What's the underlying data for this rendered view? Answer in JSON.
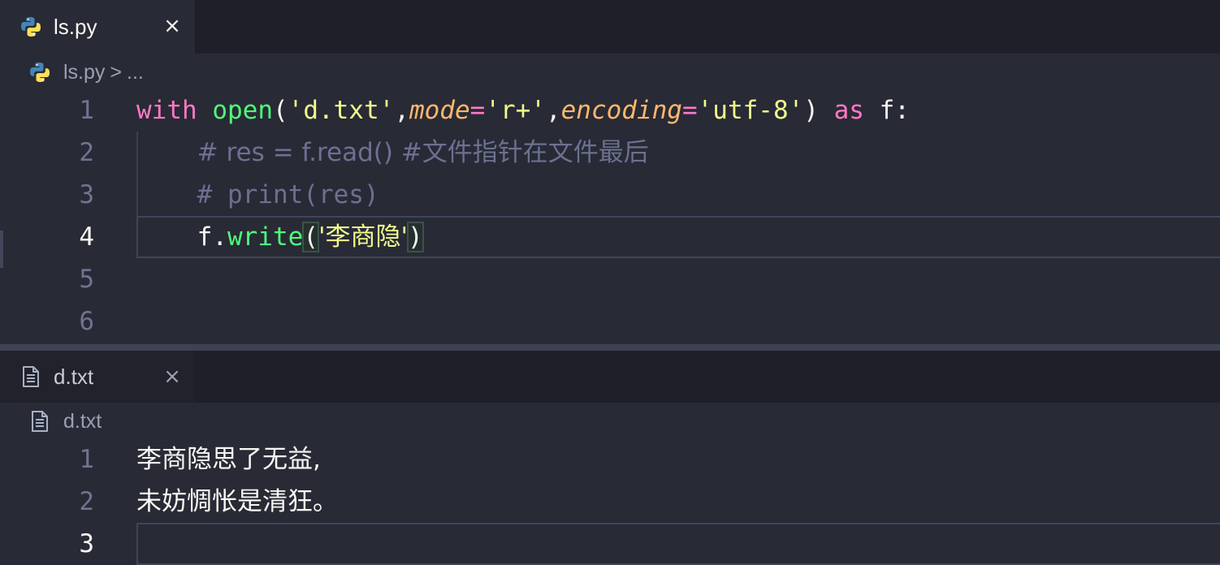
{
  "top_editor": {
    "tab": {
      "label": "ls.py",
      "close": "×",
      "icon": "python-icon"
    },
    "breadcrumb": {
      "file": "ls.py",
      "separator": ">",
      "rest": "..."
    },
    "line_numbers": [
      "1",
      "2",
      "3",
      "4",
      "5",
      "6"
    ],
    "active_line": "4",
    "code": {
      "l1": {
        "with": "with",
        "open": "open",
        "p1": "(",
        "s1": "'d.txt'",
        "c1": ",",
        "mode": "mode",
        "eq1": "=",
        "s2": "'r+'",
        "c2": ",",
        "encoding": "encoding",
        "eq2": "=",
        "s3": "'utf-8'",
        "p2": ")",
        "as": "as",
        "tail": "f:"
      },
      "l2": {
        "comment": "# res = f.read() #文件指针在文件最后"
      },
      "l3": {
        "comment": "# print(res)"
      },
      "l4": {
        "obj": "f.",
        "fn": "write",
        "p1": "(",
        "s1": "'李商隐'",
        "p2": ")"
      }
    }
  },
  "bottom_editor": {
    "tab": {
      "label": "d.txt",
      "close": "×",
      "icon": "file-text-icon"
    },
    "breadcrumb": {
      "file": "d.txt"
    },
    "line_numbers": [
      "1",
      "2",
      "3"
    ],
    "active_line": "3",
    "lines": [
      "李商隐思了无益,",
      "未妨惆怅是清狂。",
      ""
    ]
  },
  "colors": {
    "background": "#282a36",
    "keyword": "#ff79c6",
    "function": "#50fa7b",
    "string": "#f1fa8c",
    "parameter": "#ffb86c",
    "comment": "#6c7190"
  }
}
